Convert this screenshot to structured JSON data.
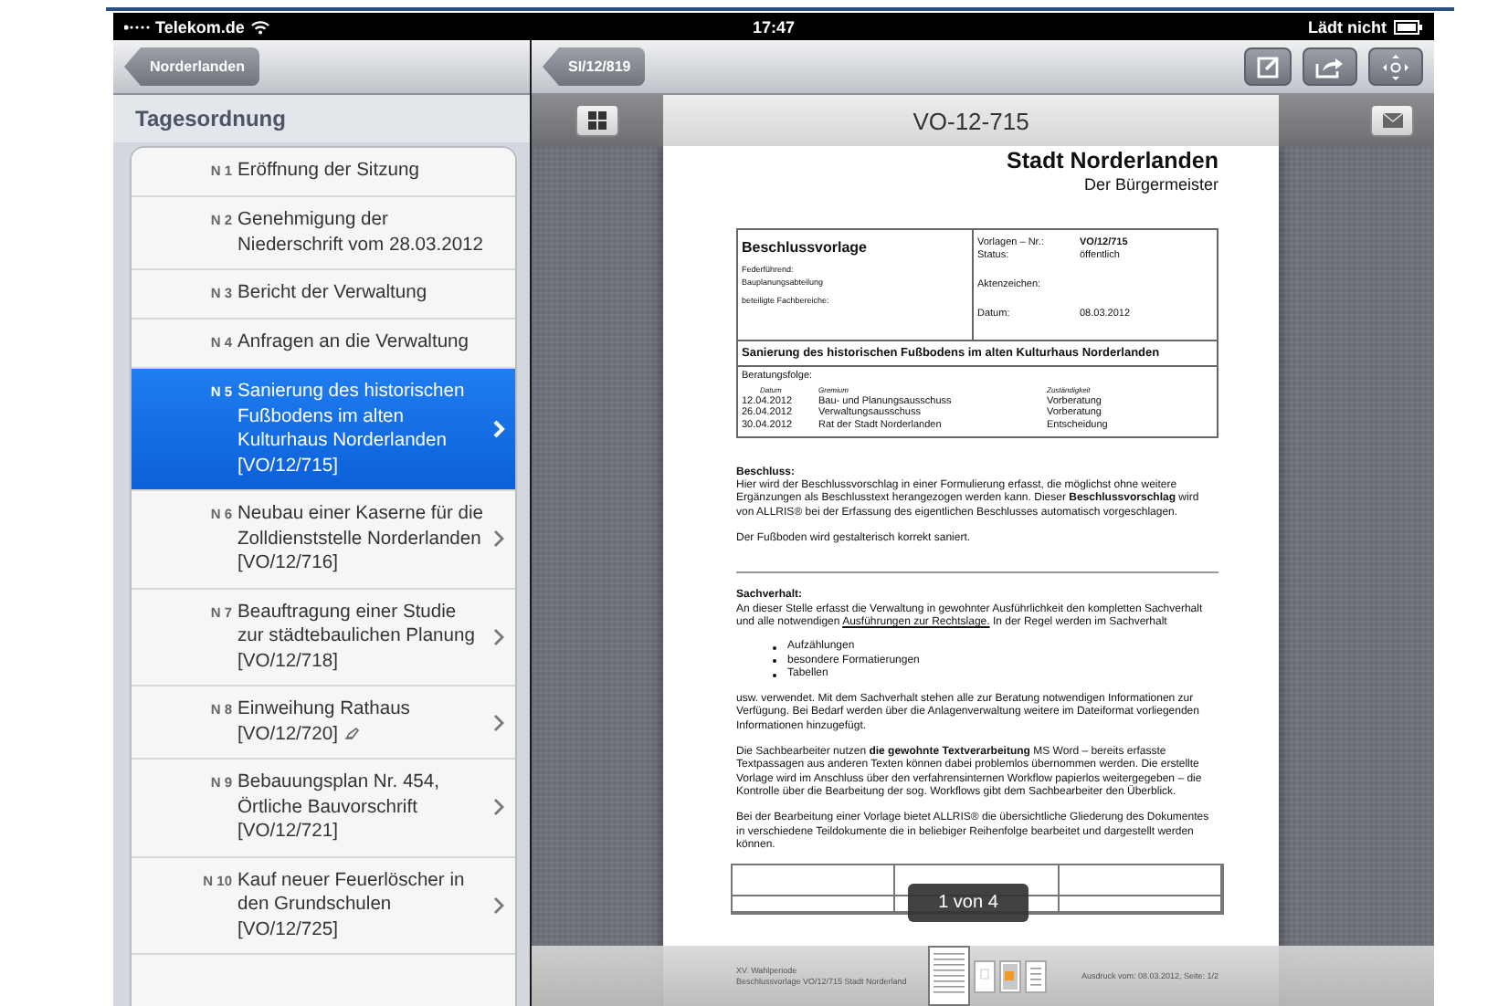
{
  "status_bar": {
    "carrier": "Telekom.de",
    "time": "17:47",
    "battery": "Lädt nicht"
  },
  "sidebar": {
    "back_button": "Norderlanden",
    "section_title": "Tagesordnung",
    "items": [
      {
        "number": "N 1",
        "title": "Eröffnung der Sitzung",
        "selected": false,
        "chevron": false,
        "annotated": false
      },
      {
        "number": "N 2",
        "title": "Genehmigung der Niederschrift vom 28.03.2012",
        "selected": false,
        "chevron": false,
        "annotated": false
      },
      {
        "number": "N 3",
        "title": "Bericht der Verwaltung",
        "selected": false,
        "chevron": false,
        "annotated": false
      },
      {
        "number": "N 4",
        "title": "Anfragen an die Verwaltung",
        "selected": false,
        "chevron": false,
        "annotated": false
      },
      {
        "number": "N 5",
        "title": "Sanierung des historischen Fußbodens im alten Kulturhaus Norderlanden [VO/12/715]",
        "selected": true,
        "chevron": true,
        "annotated": false
      },
      {
        "number": "N 6",
        "title": "Neubau einer Kaserne für die Zolldienststelle Norderlanden [VO/12/716]",
        "selected": false,
        "chevron": true,
        "annotated": false
      },
      {
        "number": "N 7",
        "title": "Beauftragung einer Studie zur städtebaulichen Planung [VO/12/718]",
        "selected": false,
        "chevron": true,
        "annotated": false
      },
      {
        "number": "N 8",
        "title": "Einweihung Rathaus [VO/12/720]",
        "selected": false,
        "chevron": true,
        "annotated": true
      },
      {
        "number": "N 9",
        "title": "Bebauungsplan Nr. 454, Örtliche  Bauvorschrift [VO/12/721]",
        "selected": false,
        "chevron": true,
        "annotated": false
      },
      {
        "number": "N 10",
        "title": "Kauf neuer Feuerlöscher in den Grundschulen [VO/12/725]",
        "selected": false,
        "chevron": true,
        "annotated": false
      }
    ]
  },
  "detail": {
    "back_button": "SI/12/819",
    "document_title": "VO-12-715",
    "page_indicator": "1 von 4",
    "thumbnails": [
      {
        "kind": "text",
        "selected": true
      },
      {
        "kind": "blank",
        "selected": false
      },
      {
        "kind": "image",
        "selected": false
      },
      {
        "kind": "text",
        "selected": false
      }
    ],
    "footer": {
      "left_lines": [
        "XV. Wahlperiode",
        "Beschlussvorlage VO/12/715 Stadt Norderland"
      ],
      "right": "Ausdruck vom: 08.03.2012, Seite: 1/2"
    }
  },
  "document": {
    "heading": "Stadt Norderlanden",
    "subheading": "Der Bürgermeister",
    "form": {
      "type": "Beschlussvorlage",
      "lead_label": "Federführend:",
      "lead_value": "Bauplanungsabteilung",
      "departments_label": "beteiligte Fachbereiche:",
      "fields": [
        {
          "label": "Vorlagen – Nr.:",
          "value": "VO/12/715",
          "strong": true
        },
        {
          "label": "Status:",
          "value": "öffentlich",
          "strong": false
        },
        {
          "label": "Aktenzeichen:",
          "strong": false
        },
        {
          "label": "Datum:",
          "value": "08.03.2012",
          "strong": false
        }
      ],
      "subject": "Sanierung des historischen Fußbodens im alten Kulturhaus Norderlanden",
      "sequence_label": "Beratungsfolge:",
      "sequence_columns": [
        "Datum",
        "Gremium",
        "Zuständigkeit"
      ],
      "sequence_rows": [
        [
          "12.04.2012",
          "Bau- und Planungsausschuss",
          "Vorberatung"
        ],
        [
          "26.04.2012",
          "Verwaltungsausschuss",
          "Vorberatung"
        ],
        [
          "30.04.2012",
          "Rat der Stadt Norderlanden",
          "Entscheidung"
        ]
      ]
    },
    "decision_heading": "Beschluss:",
    "decision_text": "Hier wird der Beschlussvorschlag in einer Formulierung erfasst, die möglichst ohne weitere Ergänzungen als Beschlusstext herangezogen werden kann. Dieser **Beschlussvorschlag** wird von ALLRIS® bei der Erfassung des eigentlichen Beschlusses automatisch vorgeschlagen.",
    "decision_note": "Der Fußboden wird gestalterisch korrekt saniert.",
    "facts_heading": "Sachverhalt:",
    "facts_intro": {
      "before": "An dieser Stelle erfasst die Verwaltung in gewohnter Ausführlichkeit den kompletten Sachverhalt und alle notwendigen",
      "link": "Ausführungen zur Rechtslage.",
      "after": "In der Regel werden im Sachverhalt"
    },
    "bullets": [
      "Aufzählungen",
      "besondere Formatierungen",
      "Tabellen"
    ],
    "paragraphs": [
      "usw. verwendet.  Mit dem Sachverhalt stehen alle zur Beratung notwendigen Informationen zur Verfügung. Bei Bedarf werden über die Anlagenverwaltung weitere im Dateiformat vorliegenden Informationen hinzugefügt.",
      "Die Sachbearbeiter nutzen **die gewohnte Textverarbeitung** MS Word – bereits erfasste Textpassagen aus anderen Texten können dabei problemlos übernommen werden. Die erstellte Vorlage wird im Anschluss über den verfahrensinternen Workflow papierlos weitergegeben – die Kontrolle über die Bearbeitung der sog. Workflows gibt dem Sachbearbeiter den Überblick.",
      "Bei der Bearbeitung einer Vorlage bietet ALLRIS® die übersichtliche Gliederung des Dokumentes in verschiedene Teildokumente die in beliebiger Reihenfolge bearbeitet und dargestellt werden können."
    ]
  }
}
